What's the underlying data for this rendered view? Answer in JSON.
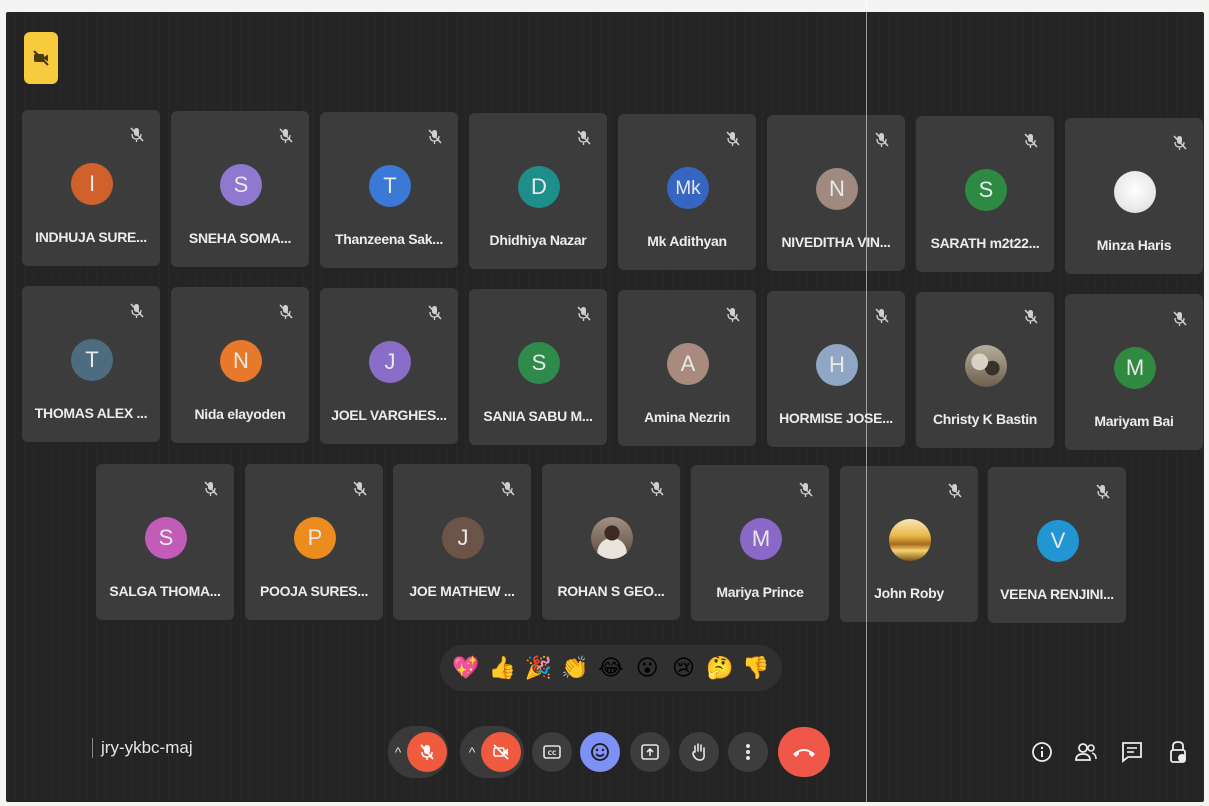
{
  "meeting": {
    "code": "jry-ykbc-maj"
  },
  "colors": {
    "stage": "#242424",
    "tile": "#3c3c3c",
    "leave": "#ef5848",
    "mic_off": "#f05a3f",
    "reactions_active": "#7e91f5",
    "badge": "#f7cb3d"
  },
  "participants": [
    {
      "name": "INDHUJA SURE...",
      "initial": "I",
      "color": "#d0612d",
      "muted": true
    },
    {
      "name": "SNEHA SOMA...",
      "initial": "S",
      "color": "#8f79cf",
      "muted": true
    },
    {
      "name": "Thanzeena Sak...",
      "initial": "T",
      "color": "#3a79d6",
      "muted": true
    },
    {
      "name": "Dhidhiya Nazar",
      "initial": "D",
      "color": "#1d8e8a",
      "muted": true
    },
    {
      "name": "Mk Adithyan",
      "initial": "Mk",
      "color": "#3566c2",
      "muted": true
    },
    {
      "name": "NIVEDITHA VIN...",
      "initial": "N",
      "color": "#a08a7f",
      "muted": true
    },
    {
      "name": "SARATH m2t22...",
      "initial": "S",
      "color": "#2d8a43",
      "muted": true
    },
    {
      "name": "Minza Haris",
      "initial": "",
      "color": "#f2f2f2",
      "muted": true,
      "photo": "white-circle"
    },
    {
      "name": "THOMAS ALEX ...",
      "initial": "T",
      "color": "#4e6c80",
      "muted": true
    },
    {
      "name": "Nida elayoden",
      "initial": "N",
      "color": "#e8782a",
      "muted": true
    },
    {
      "name": "JOEL VARGHES...",
      "initial": "J",
      "color": "#8a6cc9",
      "muted": true
    },
    {
      "name": "SANIA SABU M...",
      "initial": "S",
      "color": "#2f8b4c",
      "muted": true
    },
    {
      "name": "Amina Nezrin",
      "initial": "A",
      "color": "#a88b7e",
      "muted": true
    },
    {
      "name": "HORMISE JOSE...",
      "initial": "H",
      "color": "#8fa7c4",
      "muted": true
    },
    {
      "name": "Christy K Bastin",
      "initial": "",
      "color": "#7a6a55",
      "muted": true,
      "photo": "group-photo"
    },
    {
      "name": "Mariyam Bai",
      "initial": "M",
      "color": "#2f8a40",
      "muted": true
    },
    {
      "name": "SALGA THOMA...",
      "initial": "S",
      "color": "#c25cb9",
      "muted": true
    },
    {
      "name": "POOJA SURES...",
      "initial": "P",
      "color": "#ec8b1e",
      "muted": true
    },
    {
      "name": "JOE MATHEW ...",
      "initial": "J",
      "color": "#6c5548",
      "muted": true
    },
    {
      "name": "ROHAN S GEO...",
      "initial": "",
      "color": "#7d6b5e",
      "muted": true,
      "photo": "portrait-photo"
    },
    {
      "name": "Mariya Prince",
      "initial": "M",
      "color": "#8a68c8",
      "muted": true
    },
    {
      "name": "John Roby",
      "initial": "",
      "color": "#c79a3a",
      "muted": true,
      "photo": "sunset-photo"
    },
    {
      "name": "VEENA RENJINI...",
      "initial": "V",
      "color": "#2196d3",
      "muted": true
    }
  ],
  "reactions": [
    "💖",
    "👍",
    "🎉",
    "👏",
    "😂",
    "😮",
    "😢",
    "🤔",
    "👎"
  ],
  "controls": {
    "mic": {
      "icon": "mic-off-icon",
      "state": "off"
    },
    "camera": {
      "icon": "camera-off-icon",
      "state": "off"
    },
    "captions": {
      "icon": "captions-icon"
    },
    "reactions": {
      "icon": "emoji-icon",
      "state": "active"
    },
    "present": {
      "icon": "present-icon"
    },
    "raise_hand": {
      "icon": "hand-icon"
    },
    "more": {
      "icon": "more-vert-icon"
    },
    "leave": {
      "icon": "call-end-icon"
    }
  },
  "right_panel": [
    "info-icon",
    "people-icon",
    "chat-icon",
    "host-controls-icon"
  ]
}
